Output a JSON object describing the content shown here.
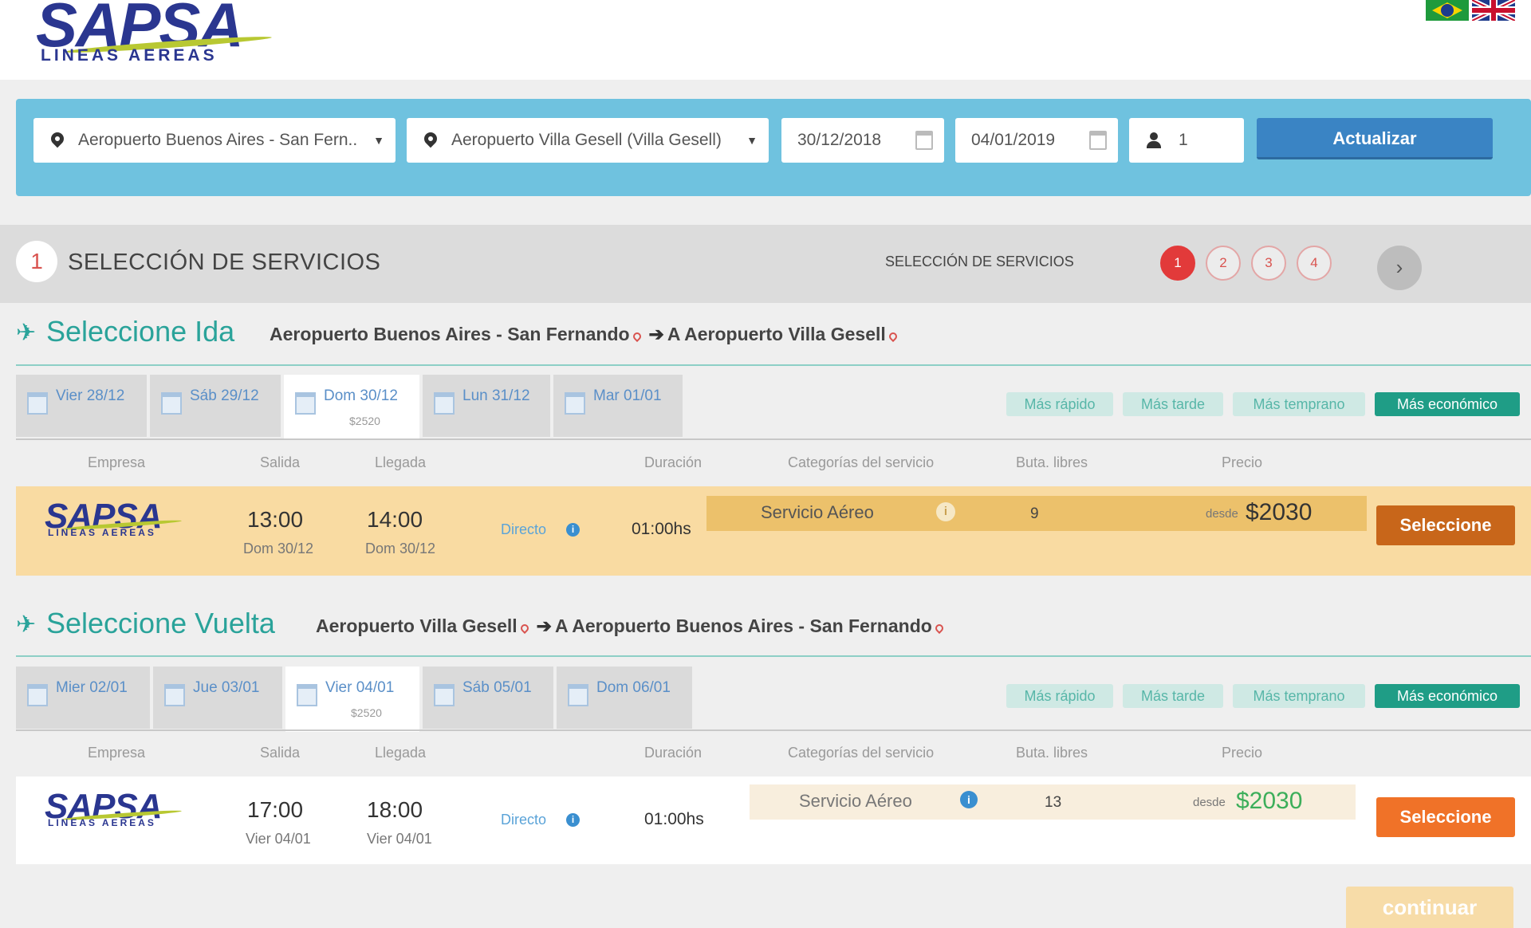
{
  "header": {
    "brand": "SAPSA",
    "brand_sub": "LINEAS AEREAS",
    "flags": [
      "brazil-flag-icon",
      "uk-flag-icon"
    ]
  },
  "search": {
    "origin": "Aeropuerto Buenos Aires - San Fern...",
    "destination": "Aeropuerto Villa Gesell (Villa Gesell)",
    "date_out": "30/12/2018",
    "date_back": "04/01/2019",
    "passengers": "1",
    "update_label": "Actualizar"
  },
  "steps": {
    "current_num": "1",
    "title": "SELECCIÓN DE SERVICIOS",
    "subtitle": "SELECCIÓN DE SERVICIOS",
    "dots": [
      "1",
      "2",
      "3",
      "4"
    ],
    "next": "›"
  },
  "ida": {
    "title": "Seleccione Ida",
    "from": "Aeropuerto Buenos Aires - San Fernando",
    "to": "A Aeropuerto Villa Gesell",
    "tabs": [
      {
        "label": "Vier 28/12",
        "price": ""
      },
      {
        "label": "Sáb 29/12",
        "price": ""
      },
      {
        "label": "Dom 30/12",
        "price": "$2520"
      },
      {
        "label": "Lun 31/12",
        "price": ""
      },
      {
        "label": "Mar 01/01",
        "price": ""
      }
    ],
    "filters": [
      "Más rápido",
      "Más tarde",
      "Más temprano",
      "Más económico"
    ],
    "columns": [
      "Empresa",
      "Salida",
      "Llegada",
      "Duración",
      "Categorías del servicio",
      "Buta. libres",
      "Precio"
    ],
    "row": {
      "logo": "SAPSA",
      "logo_sub": "LINEAS AEREAS",
      "dep_time": "13:00",
      "dep_date": "Dom 30/12",
      "arr_time": "14:00",
      "arr_date": "Dom 30/12",
      "type": "Directo",
      "duration": "01:00hs",
      "category": "Servicio Aéreo",
      "seats": "9",
      "desde": "desde",
      "price": "$2030",
      "select_label": "Seleccione"
    }
  },
  "vuelta": {
    "title": "Seleccione Vuelta",
    "from": "Aeropuerto Villa Gesell",
    "to": "A Aeropuerto Buenos Aires - San Fernando",
    "tabs": [
      {
        "label": "Mier 02/01",
        "price": ""
      },
      {
        "label": "Jue 03/01",
        "price": ""
      },
      {
        "label": "Vier 04/01",
        "price": "$2520"
      },
      {
        "label": "Sáb 05/01",
        "price": ""
      },
      {
        "label": "Dom 06/01",
        "price": ""
      }
    ],
    "filters": [
      "Más rápido",
      "Más tarde",
      "Más temprano",
      "Más económico"
    ],
    "columns": [
      "Empresa",
      "Salida",
      "Llegada",
      "Duración",
      "Categorías del servicio",
      "Buta. libres",
      "Precio"
    ],
    "row": {
      "logo": "SAPSA",
      "logo_sub": "LINEAS AEREAS",
      "dep_time": "17:00",
      "dep_date": "Vier 04/01",
      "arr_time": "18:00",
      "arr_date": "Vier 04/01",
      "type": "Directo",
      "duration": "01:00hs",
      "category": "Servicio Aéreo",
      "seats": "13",
      "desde": "desde",
      "price": "$2030",
      "select_label": "Seleccione"
    }
  },
  "continue_label": "continuar",
  "colors": {
    "teal": "#2aa39a",
    "orange": "#f07228",
    "orange_dark": "#c8661a",
    "blue": "#3a84c4",
    "red": "#e23a3a"
  }
}
